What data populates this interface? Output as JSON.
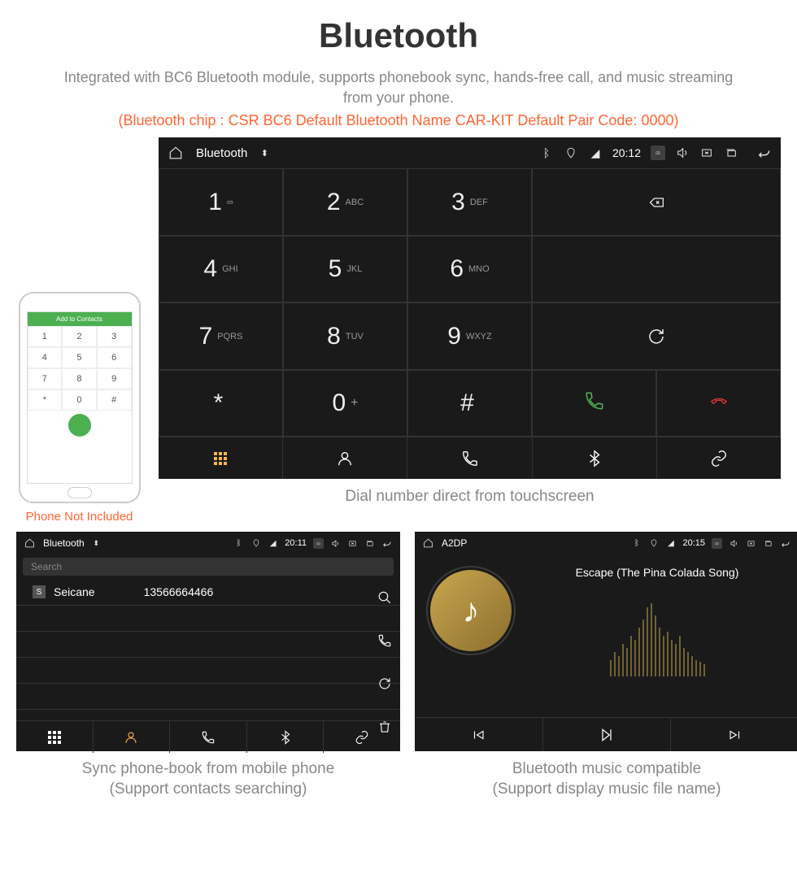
{
  "header": {
    "title": "Bluetooth",
    "subtitle": "Integrated with BC6 Bluetooth module, supports phonebook sync, hands-free call, and music streaming from your phone.",
    "specs": "(Bluetooth chip : CSR BC6     Default Bluetooth Name CAR-KIT     Default Pair Code: 0000)"
  },
  "phone_mock": {
    "header": "Add to Contacts",
    "caption": "Phone Not Included"
  },
  "main_screen": {
    "statusbar": {
      "title": "Bluetooth",
      "time": "20:12"
    },
    "keys": [
      {
        "num": "1",
        "sub": "∞"
      },
      {
        "num": "2",
        "sub": "ABC"
      },
      {
        "num": "3",
        "sub": "DEF"
      },
      {
        "num": "4",
        "sub": "GHI"
      },
      {
        "num": "5",
        "sub": "JKL"
      },
      {
        "num": "6",
        "sub": "MNO"
      },
      {
        "num": "7",
        "sub": "PQRS"
      },
      {
        "num": "8",
        "sub": "TUV"
      },
      {
        "num": "9",
        "sub": "WXYZ"
      },
      {
        "num": "*",
        "sub": ""
      },
      {
        "num": "0",
        "sub": "+"
      },
      {
        "num": "#",
        "sub": ""
      }
    ],
    "caption": "Dial number direct from touchscreen"
  },
  "contacts_screen": {
    "statusbar": {
      "title": "Bluetooth",
      "time": "20:11"
    },
    "search_placeholder": "Search",
    "contact": {
      "badge": "S",
      "name": "Seicane",
      "number": "13566664466"
    },
    "caption_line1": "Sync phone-book from mobile phone",
    "caption_line2": "(Support contacts searching)"
  },
  "music_screen": {
    "statusbar": {
      "title": "A2DP",
      "time": "20:15"
    },
    "song": "Escape (The Pina Colada Song)",
    "caption_line1": "Bluetooth music compatible",
    "caption_line2": "(Support display music file name)"
  }
}
